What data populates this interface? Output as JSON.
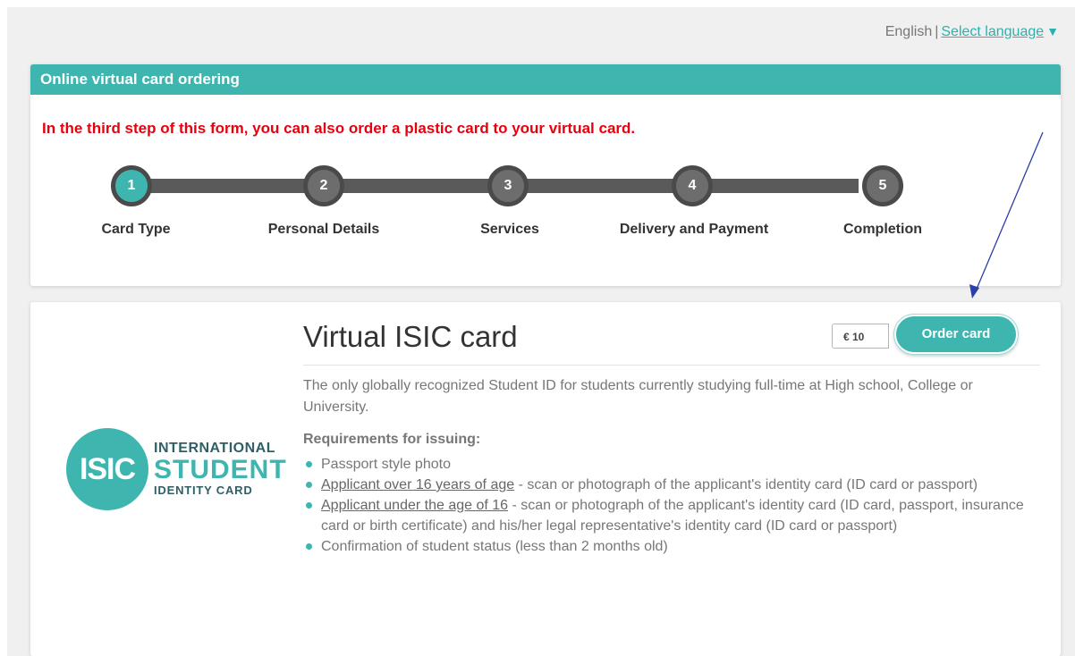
{
  "language": {
    "current": "English",
    "separator": "|",
    "select_label": "Select language"
  },
  "header": {
    "title": "Online virtual card ordering",
    "notice": "In the third step of this form, you can also order a plastic card to your virtual card."
  },
  "steps": [
    {
      "number": "1",
      "label": "Card Type",
      "active": true
    },
    {
      "number": "2",
      "label": "Personal Details",
      "active": false
    },
    {
      "number": "3",
      "label": "Services",
      "active": false
    },
    {
      "number": "4",
      "label": "Delivery and Payment",
      "active": false
    },
    {
      "number": "5",
      "label": "Completion",
      "active": false
    }
  ],
  "product": {
    "title": "Virtual ISIC card",
    "price": "€ 10",
    "order_label": "Order card",
    "description": "The only globally recognized Student ID for students currently studying full-time at High school, College or University.",
    "requirements_title": "Requirements for issuing:",
    "requirements": [
      {
        "link": "",
        "text": "Passport style photo"
      },
      {
        "link": "Applicant over 16 years of age",
        "text": " - scan or photograph of the applicant's identity card (ID card or passport)"
      },
      {
        "link": "Applicant under the age of 16",
        "text": " - scan or photograph of the applicant's identity card (ID card, passport, insurance card or birth certificate) and his/her legal representative's identity card (ID card or passport)"
      },
      {
        "link": "",
        "text": "Confirmation of student status (less than 2 months old)"
      }
    ],
    "logo": {
      "circle_text": "ISIC",
      "line1": "INTERNATIONAL",
      "line2": "STUDENT",
      "line3": "IDENTITY CARD"
    }
  },
  "colors": {
    "accent": "#3fb5b0",
    "notice": "#e8000e",
    "step_inactive": "#6d6d6d",
    "annotation_arrow": "#2b3fa8"
  }
}
